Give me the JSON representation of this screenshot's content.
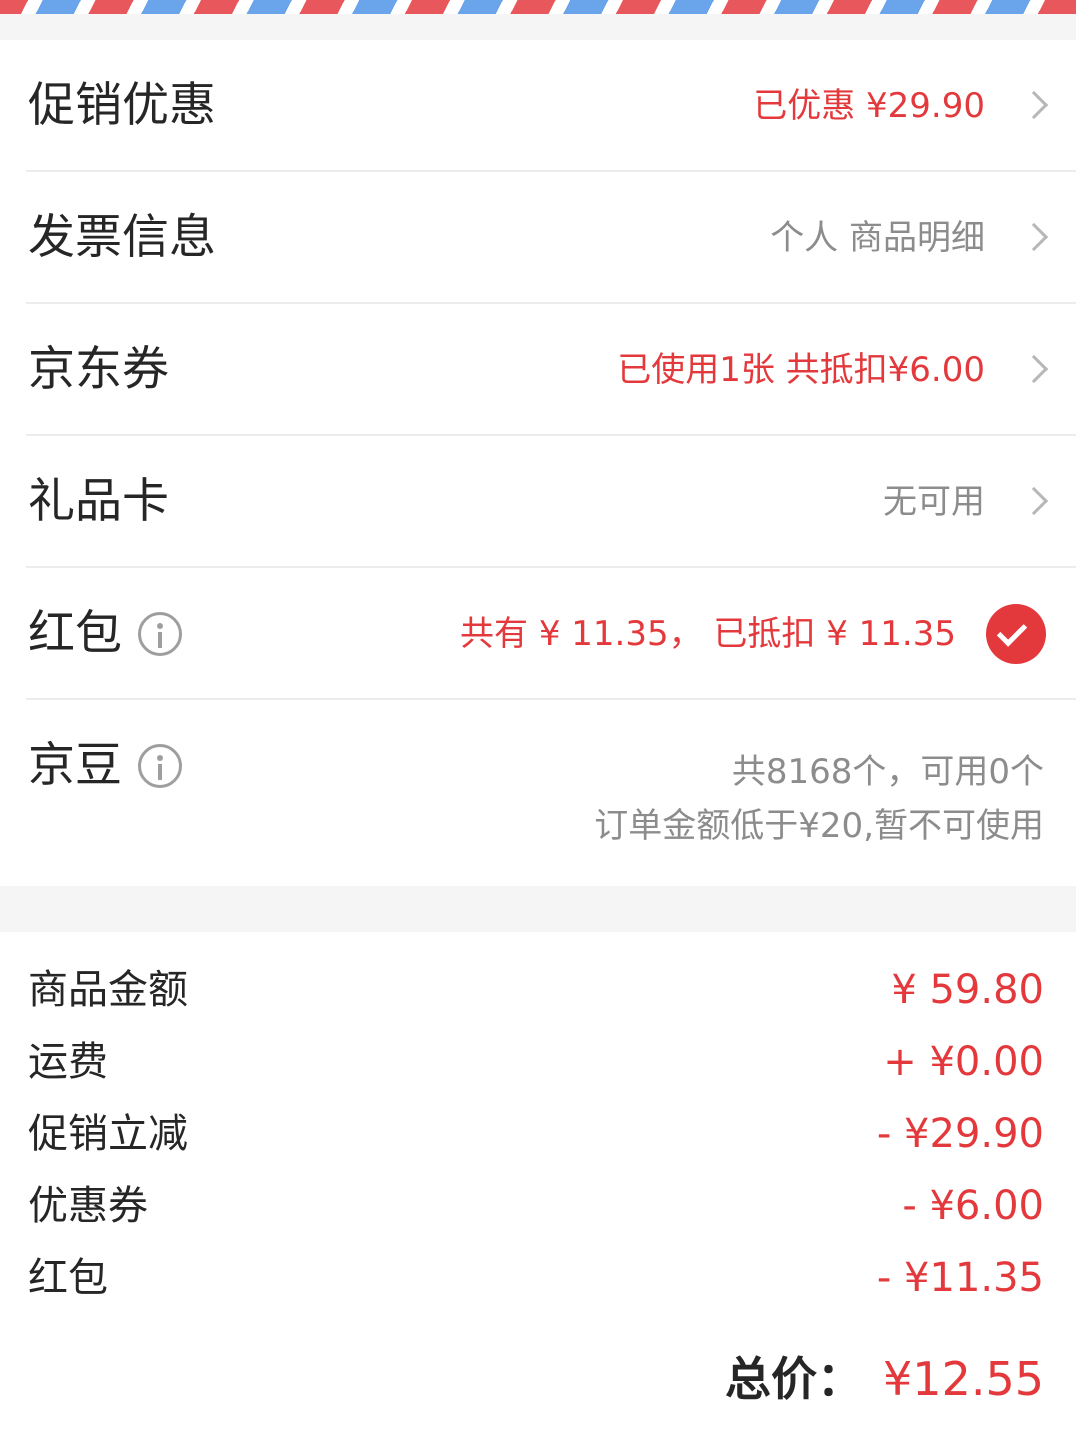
{
  "colors": {
    "accent": "#e4393c",
    "text": "#262626",
    "muted": "#8c8c8c",
    "stripe_red": "#e8575c",
    "stripe_blue": "#6aa4ea"
  },
  "options": {
    "promotion": {
      "label": "促销优惠",
      "value": "已优惠 ¥29.90"
    },
    "invoice": {
      "label": "发票信息",
      "value": "个人 商品明细"
    },
    "jd_coupon": {
      "label": "京东券",
      "value": "已使用1张 共抵扣¥6.00"
    },
    "gift_card": {
      "label": "礼品卡",
      "value": "无可用"
    },
    "red_packet": {
      "label": "红包",
      "value": "共有 ¥ 11.35， 已抵扣 ¥ 11.35",
      "checked": true
    },
    "jd_beans": {
      "label": "京豆",
      "line1": "共8168个，可用0个",
      "line2": "订单金额低于¥20,暂不可使用"
    }
  },
  "summary": {
    "items": [
      {
        "label": "商品金额",
        "value": "¥ 59.80"
      },
      {
        "label": "运费",
        "value": "+ ¥0.00"
      },
      {
        "label": "促销立减",
        "value": "- ¥29.90"
      },
      {
        "label": "优惠券",
        "value": "- ¥6.00"
      },
      {
        "label": "红包",
        "value": "- ¥11.35"
      }
    ],
    "total_label": "总价：",
    "total_value": "¥12.55"
  }
}
